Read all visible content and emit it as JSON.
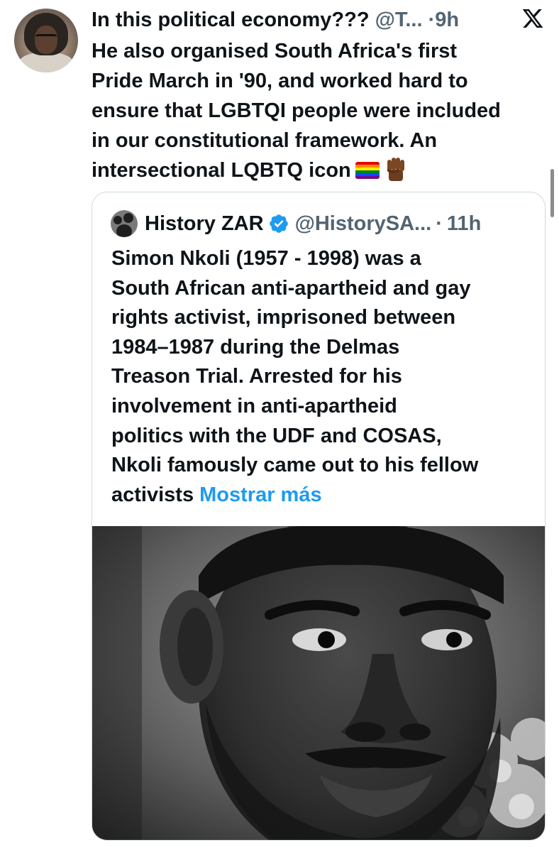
{
  "tweet": {
    "author_name": "In this political economy???",
    "handle": "@T...",
    "separator": "·",
    "time": "9h",
    "text_lines": [
      "He also organised South Africa's first",
      "Pride March in '90, and worked hard to",
      "ensure that LGBTQI people were included",
      "in our constitutional framework. An",
      "intersectional LQBTQ icon"
    ],
    "emoji": [
      "rainbow-flag",
      "raised-fist"
    ]
  },
  "quoted_tweet": {
    "author_name": "History ZAR",
    "handle": "@HistorySA...",
    "separator": "·",
    "time": "11h",
    "text_lines": [
      "Simon Nkoli (1957 - 1998) was a",
      "South African anti-apartheid and gay",
      "rights activist, imprisoned between",
      "1984–1987 during the Delmas",
      "Treason Trial. Arrested for his",
      "involvement in anti-apartheid",
      "politics with the UDF and COSAS,",
      "Nkoli famously came out to his fellow",
      "activists"
    ],
    "show_more_label": "Mostrar más",
    "verified": true,
    "has_photo": true
  },
  "colors": {
    "text": "#0f1419",
    "secondary": "#536471",
    "link": "#1d9bf0",
    "border": "#cfd9de",
    "verified_badge": "#1d9bf0"
  }
}
